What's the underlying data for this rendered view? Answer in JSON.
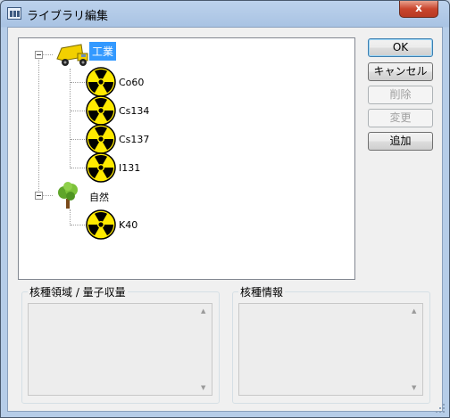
{
  "window": {
    "title": "ライブラリ編集",
    "close_glyph": "x"
  },
  "tree": {
    "groups": [
      {
        "label": "工業",
        "icon": "dump-truck-icon",
        "expanded": true,
        "items": [
          "Co60",
          "Cs134",
          "Cs137",
          "I131"
        ]
      },
      {
        "label": "自然",
        "icon": "tree-icon",
        "expanded": true,
        "items": [
          "K40"
        ]
      }
    ],
    "item_icon": "radiation-icon",
    "selected": "工業"
  },
  "buttons": {
    "ok": "OK",
    "cancel": "キャンセル",
    "delete": "削除",
    "change": "変更",
    "add": "追加"
  },
  "panels": {
    "nuclide_range": "核種領域 / 量子収量",
    "nuclide_info": "核種情報"
  },
  "colors": {
    "selection": "#3399ff",
    "close_button": "#c9452d",
    "radiation_yellow": "#ffea00"
  }
}
